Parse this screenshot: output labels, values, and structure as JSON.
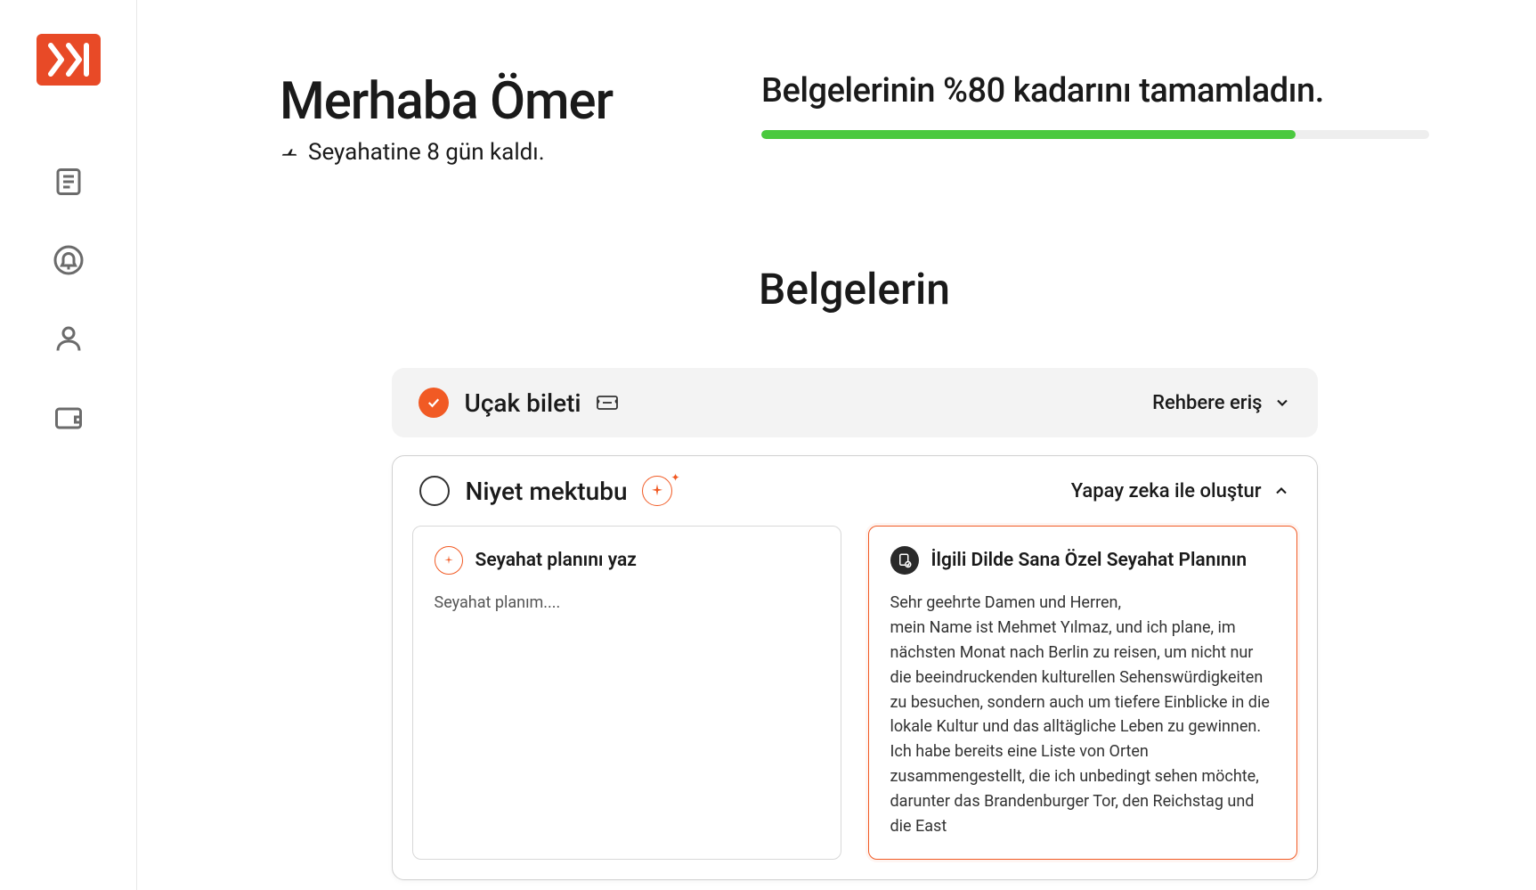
{
  "greeting": "Merhaba Ömer",
  "countdown": "Seyahatine 8 gün kaldı.",
  "progress": {
    "label": "Belgelerinin %80 kadarını tamamladın.",
    "percent": 80
  },
  "section_title": "Belgelerin",
  "docs": {
    "ticket": {
      "title": "Uçak bileti",
      "action": "Rehbere eriş",
      "completed": true
    },
    "letter": {
      "title": "Niyet mektubu",
      "action": "Yapay zeka ile oluştur",
      "completed": false,
      "left_panel": {
        "title": "Seyahat planını yaz",
        "content": "Seyahat planım...."
      },
      "right_panel": {
        "title": "İlgili Dilde Sana Özel Seyahat Planının",
        "content": "Sehr geehrte Damen und Herren,\nmein Name ist Mehmet Yılmaz, und ich plane, im nächsten Monat nach Berlin zu reisen, um nicht nur die beeindruckenden kulturellen Sehenswürdigkeiten zu besuchen, sondern auch um tiefere Einblicke in die lokale Kultur und das alltägliche Leben zu gewinnen. Ich habe bereits eine Liste von Orten zusammengestellt, die ich unbedingt sehen möchte, darunter das Brandenburger Tor, den Reichstag und die East"
      }
    }
  },
  "colors": {
    "accent": "#f15a24",
    "progress_green": "#4ac93e"
  }
}
